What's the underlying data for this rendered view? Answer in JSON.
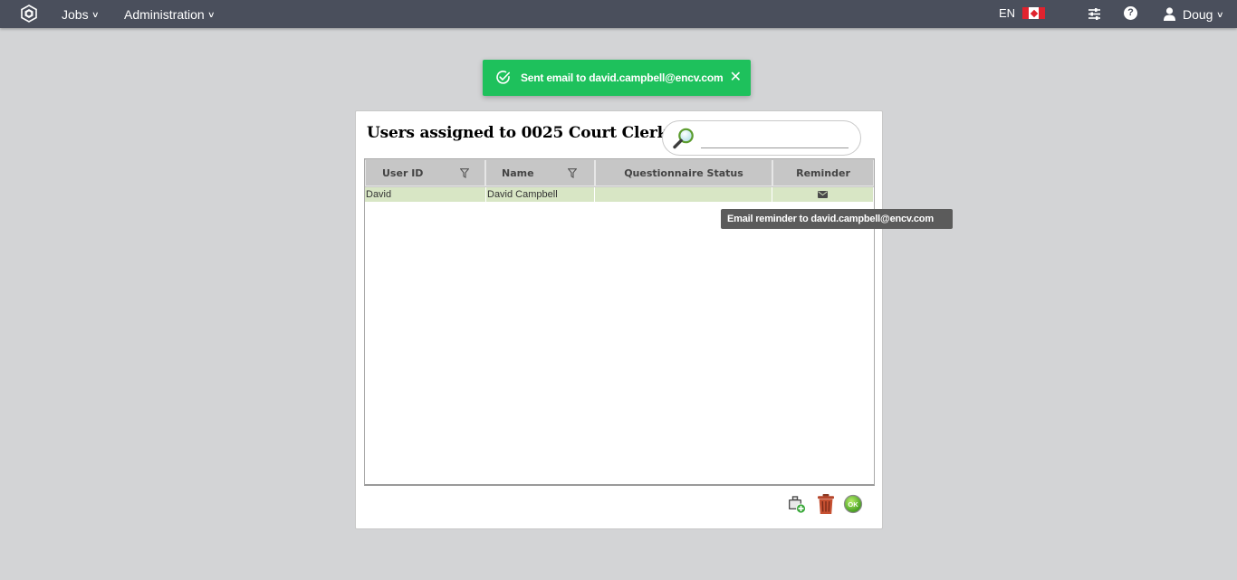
{
  "nav": {
    "jobs_label": "Jobs",
    "admin_label": "Administration",
    "language": "EN",
    "user_name": "Doug",
    "help_glyph": "?",
    "chevron": "⌄"
  },
  "toast": {
    "message": "Sent email to david.campbell@encv.com",
    "close": "✕",
    "color": "#1ec15c"
  },
  "panel": {
    "title": "Users assigned to 0025 Court Clerk",
    "search_placeholder": ""
  },
  "grid": {
    "columns": [
      "User ID",
      "Name",
      "Questionnaire Status",
      "Reminder"
    ],
    "rows": [
      {
        "user_id": "David",
        "name": "David Campbell",
        "status": ""
      }
    ],
    "selected_row_color": "#d8e6c5"
  },
  "tooltip": {
    "text": "Email reminder to david.campbell@encv.com"
  },
  "icons": {
    "logo": "app-logo",
    "settings": "sliders-icon",
    "help": "help-icon",
    "user": "user-icon",
    "flag": "canada-flag-icon",
    "search": "magnifier-icon",
    "mail": "envelope-icon",
    "add": "add-user-briefcase-icon",
    "delete": "trash-icon",
    "ok": "ok-icon"
  },
  "colors": {
    "topbar": "#4a4f5c",
    "background": "#d3d4d6"
  }
}
